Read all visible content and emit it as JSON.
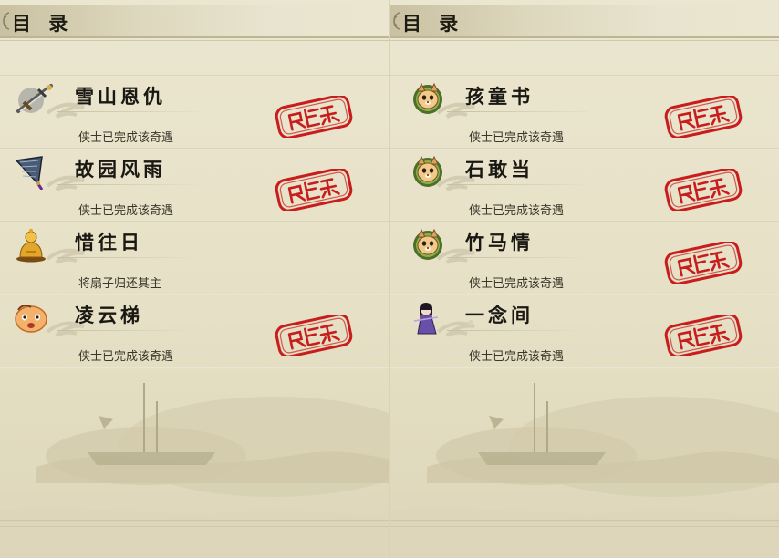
{
  "colors": {
    "stamp_red": "#c81d1d",
    "ink": "#1a1812",
    "paper": "#e6e0c7"
  },
  "pages": {
    "left": {
      "header_title": "目 录",
      "entries": [
        {
          "name": "雪山恩仇",
          "status": "侠士已完成该奇遇",
          "icon": "sword-icon",
          "completed": true
        },
        {
          "name": "故园风雨",
          "status": "侠士已完成该奇遇",
          "icon": "fan-icon",
          "completed": true
        },
        {
          "name": "惜往日",
          "status": "将扇子归还其主",
          "icon": "buddha-icon",
          "completed": false
        },
        {
          "name": "凌云梯",
          "status": "侠士已完成该奇遇",
          "icon": "face-icon",
          "completed": true
        }
      ]
    },
    "right": {
      "header_title": "目 录",
      "entries": [
        {
          "name": "孩童书",
          "status": "侠士已完成该奇遇",
          "icon": "cat-icon",
          "completed": true
        },
        {
          "name": "石敢当",
          "status": "侠士已完成该奇遇",
          "icon": "cat-icon",
          "completed": true
        },
        {
          "name": "竹马情",
          "status": "侠士已完成该奇遇",
          "icon": "cat-icon",
          "completed": true
        },
        {
          "name": "一念间",
          "status": "侠士已完成该奇遇",
          "icon": "maiden-icon",
          "completed": true
        }
      ]
    }
  }
}
